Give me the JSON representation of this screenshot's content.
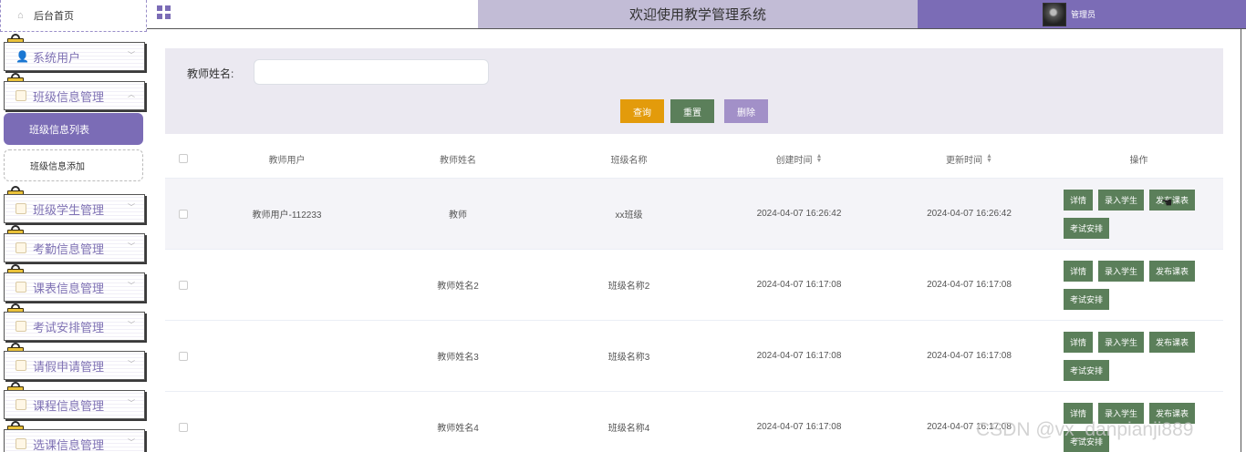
{
  "sidebar": {
    "home_label": "后台首页",
    "menus": [
      {
        "label": "系统用户"
      },
      {
        "label": "班级信息管理"
      },
      {
        "label": "班级学生管理"
      },
      {
        "label": "考勤信息管理"
      },
      {
        "label": "课表信息管理"
      },
      {
        "label": "考试安排管理"
      },
      {
        "label": "请假申请管理"
      },
      {
        "label": "课程信息管理"
      },
      {
        "label": "选课信息管理"
      }
    ],
    "submenu": {
      "active": "班级信息列表",
      "add": "班级信息添加"
    }
  },
  "header": {
    "title": "欢迎使用教学管理系统",
    "username": "管理员"
  },
  "search": {
    "label": "教师姓名:",
    "value": "",
    "btn_query": "查询",
    "btn_reset": "重置",
    "btn_delete": "删除"
  },
  "table": {
    "columns": [
      "教师用户",
      "教师姓名",
      "班级名称",
      "创建时间",
      "更新时间",
      "操作"
    ],
    "rows": [
      {
        "user": "教师用户-112233",
        "name": "教师",
        "class": "xx班级",
        "created": "2024-04-07 16:26:42",
        "updated": "2024-04-07 16:26:42"
      },
      {
        "user": "",
        "name": "教师姓名2",
        "class": "班级名称2",
        "created": "2024-04-07 16:17:08",
        "updated": "2024-04-07 16:17:08"
      },
      {
        "user": "",
        "name": "教师姓名3",
        "class": "班级名称3",
        "created": "2024-04-07 16:17:08",
        "updated": "2024-04-07 16:17:08"
      },
      {
        "user": "",
        "name": "教师姓名4",
        "class": "班级名称4",
        "created": "2024-04-07 16:17:08",
        "updated": "2024-04-07 16:17:08"
      }
    ],
    "ops": {
      "detail": "详情",
      "enroll": "录入学生",
      "publish": "发布课表",
      "exam": "考试安排"
    }
  },
  "watermark": "CSDN @vx_danpianji889",
  "colors": {
    "accent": "#7b6cb6",
    "title_bar": "#c2bcd6",
    "op_button": "#5b7f5a",
    "query": "#e39b0b",
    "delete": "#a290c8"
  }
}
